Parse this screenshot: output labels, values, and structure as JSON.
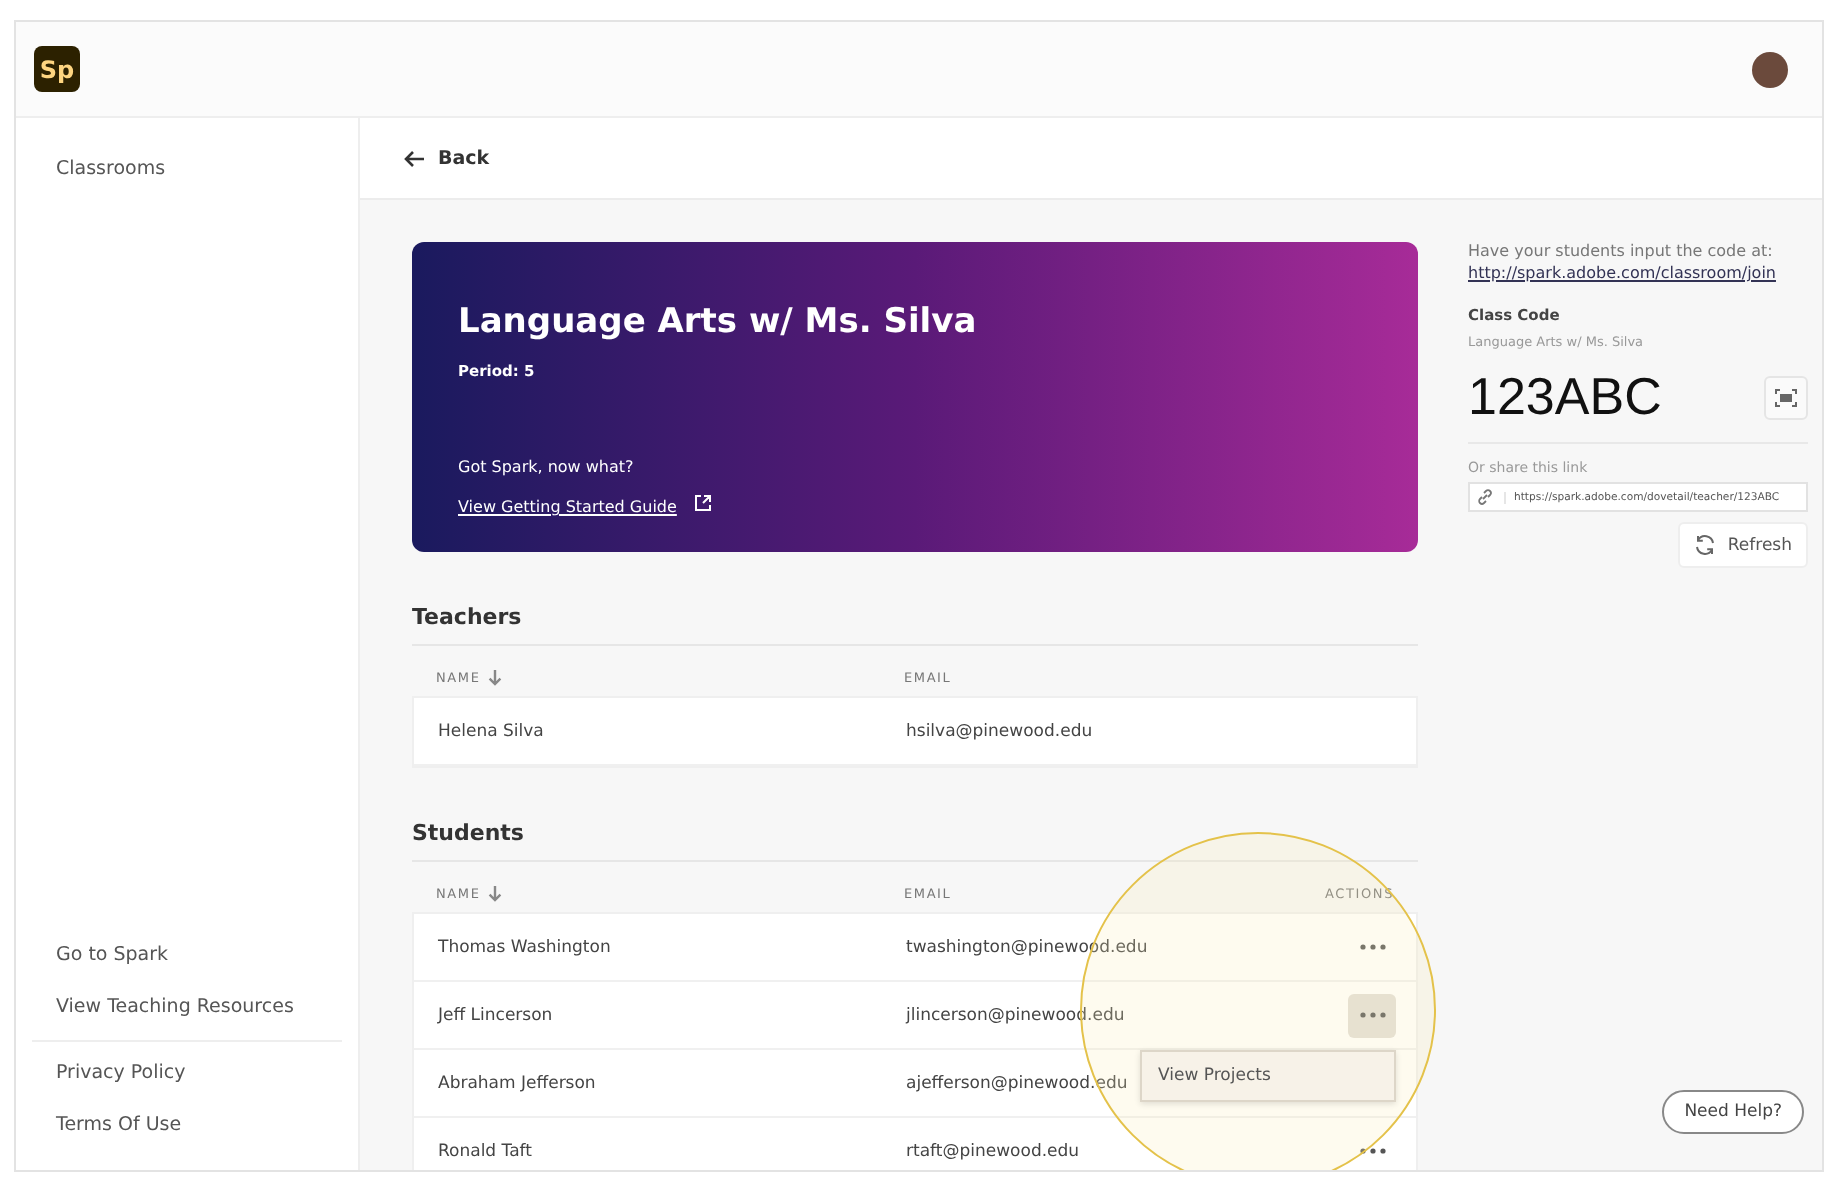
{
  "app": {
    "logo": "Sp"
  },
  "sidebar": {
    "top_items": [
      {
        "label": "Classrooms"
      }
    ],
    "bottom_items": [
      {
        "label": "Go to Spark"
      },
      {
        "label": "View Teaching Resources"
      }
    ],
    "legal_items": [
      {
        "label": "Privacy Policy"
      },
      {
        "label": "Terms Of Use"
      }
    ]
  },
  "back": {
    "label": "Back"
  },
  "class_card": {
    "title": "Language Arts w/ Ms. Silva",
    "period": "Period: 5",
    "prompt": "Got Spark, now what?",
    "guide_link": "View Getting Started Guide"
  },
  "join_panel": {
    "instruction": "Have your students input the code at:",
    "join_url": "http://spark.adobe.com/classroom/join",
    "code_label": "Class Code",
    "class_name": "Language Arts w/ Ms. Silva",
    "code": "123ABC",
    "share_label": "Or share this link",
    "share_url": "https://spark.adobe.com/dovetail/teacher/123ABC",
    "refresh_button": "Refresh"
  },
  "teachers": {
    "heading": "Teachers",
    "columns": [
      {
        "label": "NAME",
        "sorted": true
      },
      {
        "label": "EMAIL",
        "sorted": false
      }
    ],
    "rows": [
      {
        "name": "Helena Silva",
        "email": "hsilva@pinewood.edu"
      }
    ]
  },
  "students": {
    "heading": "Students",
    "columns": [
      {
        "label": "NAME",
        "sorted": true
      },
      {
        "label": "EMAIL",
        "sorted": false
      },
      {
        "label": "ACTIONS",
        "sorted": false
      }
    ],
    "rows": [
      {
        "name": "Thomas Washington",
        "email": "twashington@pinewood.edu",
        "menu_open": false
      },
      {
        "name": "Jeff Lincerson",
        "email": "jlincerson@pinewood.edu",
        "menu_open": true
      },
      {
        "name": "Abraham Jefferson",
        "email": "ajefferson@pinewood.edu",
        "menu_open": false
      },
      {
        "name": "Ronald Taft",
        "email": "rtaft@pinewood.edu",
        "menu_open": false
      }
    ]
  },
  "action_menu": {
    "items": [
      "View Projects"
    ]
  },
  "help_button": "Need Help?"
}
